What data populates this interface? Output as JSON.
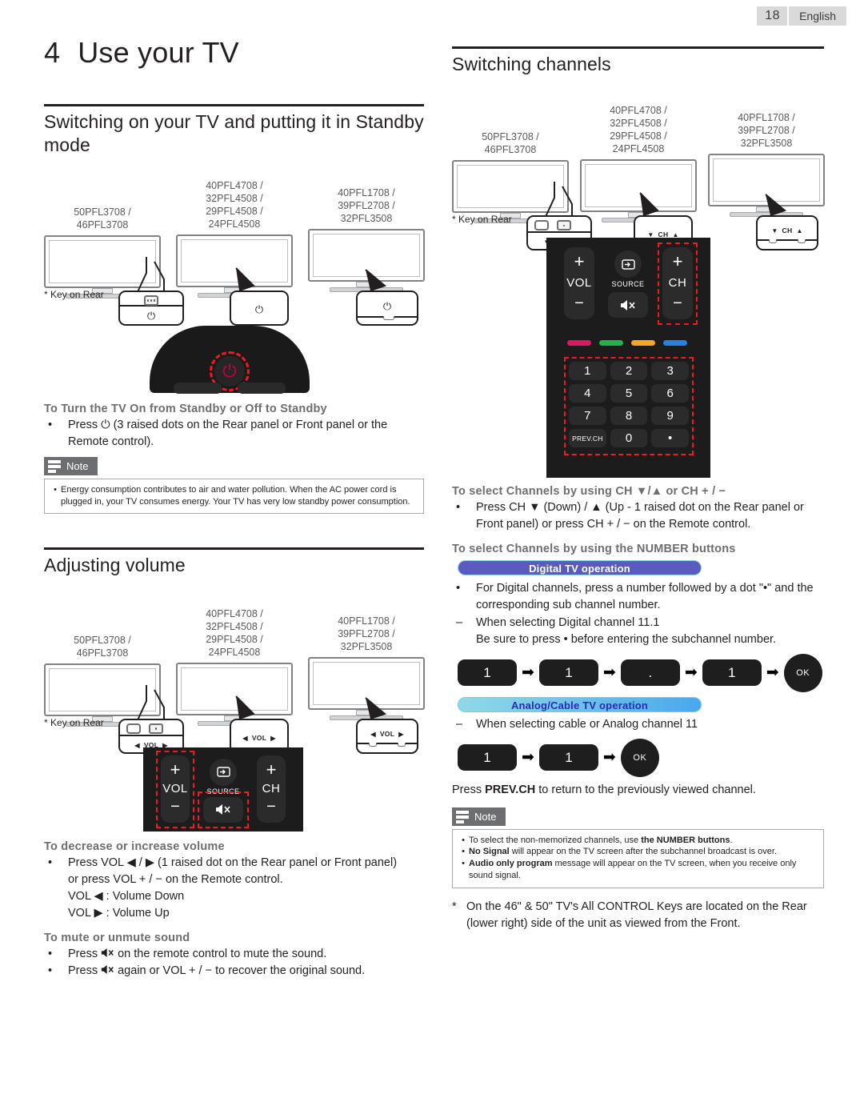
{
  "header": {
    "page_number": "18",
    "language": "English"
  },
  "chapter": {
    "number": "4",
    "title": "Use your TV"
  },
  "left": {
    "section1_title": "Switching on your TV and putting it in Standby mode",
    "tv_models": [
      "50PFL3708 /\n46PFL3708",
      "40PFL4708 /\n32PFL4508 /\n29PFL4508 /\n24PFL4508",
      "40PFL1708 /\n39PFL2708 /\n32PFL3508"
    ],
    "key_on_rear": "* Key on Rear",
    "power_glyph": "⏻",
    "subhead_turn_on": "To Turn the TV On from Standby or Off to Standby",
    "bullet": "•",
    "turn_on_text_a": "Press ",
    "turn_on_text_b": " (3 raised dots on the Rear panel or Front panel or the Remote control).",
    "note_label": "Note",
    "note_items": [
      "Energy consumption contributes to air and water pollution. When the AC power cord is plugged in, your TV consumes energy. Your TV has very low standby power consumption."
    ],
    "section2_title": "Adjusting volume",
    "vol_label": "VOL",
    "vol_left_arrow": "◀",
    "vol_right_arrow": "▶",
    "subhead_volume": "To decrease or increase volume",
    "volume_line1": "Press VOL ◀ / ▶ (1 raised dot on the Rear panel or Front panel)",
    "volume_line2": "or press VOL + / − on the Remote control.",
    "volume_line3": "VOL ◀ : Volume Down",
    "volume_line4": "VOL ▶ : Volume Up",
    "subhead_mute": "To mute or unmute sound",
    "mute_line1_a": "Press ",
    "mute_line1_b": " on the remote control to mute the sound.",
    "mute_line2_a": "Press ",
    "mute_line2_b": " again or VOL + / − to recover the original sound.",
    "remote": {
      "vol_plus": "+",
      "vol_name": "VOL",
      "vol_minus": "−",
      "source_label": "SOURCE",
      "source_glyph": "⏏",
      "ch_plus": "+",
      "ch_name": "CH",
      "ch_minus": "−",
      "mute_glyph": "🔇"
    }
  },
  "right": {
    "section_title": "Switching channels",
    "tv_models": [
      "50PFL3708 /\n46PFL3708",
      "40PFL4708 /\n32PFL4508 /\n29PFL4508 /\n24PFL4508",
      "40PFL1708 /\n39PFL2708 /\n32PFL3508"
    ],
    "key_on_rear": "* Key on Rear",
    "ch_label": "CH",
    "ch_down_arrow": "▼",
    "ch_up_arrow": "▲",
    "remote": {
      "vol_plus": "+",
      "vol_name": "VOL",
      "vol_minus": "−",
      "source_label": "SOURCE",
      "source_glyph": "⏏",
      "ch_plus": "+",
      "ch_name": "CH",
      "ch_minus": "−",
      "mute_glyph": "🔇",
      "color_buttons": [
        "#d81b60",
        "#22b14c",
        "#f5a623",
        "#2a7fe0"
      ],
      "numpad": [
        "1",
        "2",
        "3",
        "4",
        "5",
        "6",
        "7",
        "8",
        "9",
        "PREV.CH",
        "0",
        "•"
      ]
    },
    "subhead_ch": "To select Channels by using CH ▼/▲ or CH + / −",
    "ch_line1": "Press CH ▼ (Down) / ▲ (Up - 1 raised dot on the Rear panel or",
    "ch_line2": "Front panel) or press CH + / − on the Remote control.",
    "subhead_number": "To select Channels by using the NUMBER buttons",
    "badge_digital": "Digital TV operation",
    "digital_bullet_line1": "For Digital channels, press a number followed by a dot \"•\" and the",
    "digital_bullet_line2": "corresponding sub channel number.",
    "digital_dash_line1": "When selecting Digital channel 11.1",
    "digital_dash_line2": "Be sure to press • before entering the subchannel number.",
    "digital_sequence": [
      "1",
      "1",
      ".",
      "1"
    ],
    "ok_label": "OK",
    "arrow": "➡",
    "badge_analog": "Analog/Cable TV operation",
    "analog_dash_line": "When selecting cable or Analog channel 11",
    "analog_sequence": [
      "1",
      "1"
    ],
    "prev_ch_line_a": "Press ",
    "prev_ch_bold": "PREV.CH",
    "prev_ch_line_b": " to return to the previously viewed channel.",
    "note_label": "Note",
    "note_items": [
      {
        "plain_a": "To select the non-memorized channels, use ",
        "bold": "the NUMBER buttons",
        "plain_b": "."
      },
      {
        "bold_first": "No Signal",
        "plain": " will appear on the TV screen after the subchannel broadcast is over."
      },
      {
        "bold_first": "Audio only program",
        "plain": " message will appear on the TV screen, when you receive only sound signal."
      }
    ],
    "footnote_star": "*",
    "footnote_line1": "On the 46\" & 50\" TV's All CONTROL Keys are located on the Rear",
    "footnote_line2": "(lower right) side of the unit as viewed from the Front.",
    "bullet": "•",
    "dash": "–"
  }
}
